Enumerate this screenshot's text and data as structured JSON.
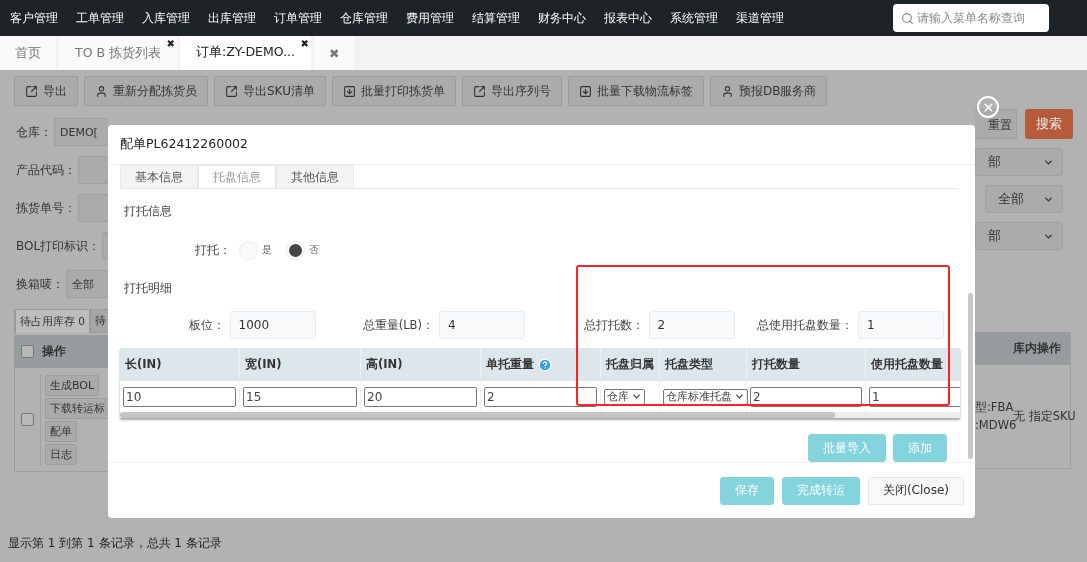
{
  "nav": {
    "items": [
      "客户管理",
      "工单管理",
      "入库管理",
      "出库管理",
      "订单管理",
      "仓库管理",
      "费用管理",
      "结算管理",
      "财务中心",
      "报表中心",
      "系统管理",
      "渠道管理"
    ],
    "search": {
      "placeholder": "请输入菜单名称查询"
    }
  },
  "page_tabs": [
    {
      "label": "首页",
      "selected": false
    },
    {
      "label": "TO B 拣货列表",
      "close": "✖",
      "selected": false
    },
    {
      "label": "订单:ZY-DEMO...",
      "close": "✖",
      "selected": true
    },
    {
      "label": "✖",
      "selected": false
    }
  ],
  "toolbar": [
    {
      "label": "导出",
      "kind": "export"
    },
    {
      "label": "重新分配拣货员",
      "kind": "user"
    },
    {
      "label": "导出SKU清单",
      "kind": "export"
    },
    {
      "label": "批量打印拣货单",
      "kind": "download"
    },
    {
      "label": "导出序列号",
      "kind": "export"
    },
    {
      "label": "批量下载物流标签",
      "kind": "download"
    },
    {
      "label": "预报DB服务商",
      "kind": "user"
    }
  ],
  "filters": [
    {
      "label": "仓库：",
      "value": "DEMO["
    },
    {
      "label": "产品代码："
    },
    {
      "label": "拣货单号："
    },
    {
      "label": "BOL打印标识："
    },
    {
      "label": "换箱唛：",
      "value": "全部"
    }
  ],
  "filter_actions": {
    "reset": "重置",
    "search": "搜索"
  },
  "right_selects": [
    "部",
    "全部",
    "部"
  ],
  "list_table": {
    "tabs": [
      {
        "label": "待占用库存 0",
        "selected": true
      },
      {
        "label": "待",
        "selected": false
      }
    ],
    "header_checked": false,
    "action_column": "操作",
    "last_column": "库内操作",
    "rows": [
      {
        "checked": false,
        "actions": [
          "生成BOL",
          "下载转运标",
          "配单",
          "日志"
        ],
        "info_lines": [
          "型:FBA",
          ":MDW6"
        ],
        "inner_op": "无 指定SKU"
      }
    ]
  },
  "footer": "显示第 1 到第 1 条记录，总共 1 条记录",
  "dialog": {
    "title": "配单PL62412260002",
    "tabs": [
      {
        "label": "基本信息",
        "selected": false
      },
      {
        "label": "托盘信息",
        "selected": true
      },
      {
        "label": "其他信息",
        "selected": false
      }
    ],
    "section_info": "打托信息",
    "palletize": {
      "label": "打托：",
      "options": [
        {
          "label": "是",
          "selected": false
        },
        {
          "label": "否",
          "selected": true
        }
      ]
    },
    "section_detail": "打托明细",
    "summary": [
      {
        "label": "板位：",
        "value": "1000"
      },
      {
        "label": "总重量(LB)：",
        "value": "4"
      },
      {
        "label": "总打托数：",
        "value": "2"
      },
      {
        "label": "总使用托盘数量：",
        "value": "1"
      }
    ],
    "detail_table": {
      "columns": [
        {
          "label": "长(IN)"
        },
        {
          "label": "宽(IN)"
        },
        {
          "label": "高(IN)"
        },
        {
          "label": "单托重量",
          "help": true
        },
        {
          "label": "托盘归属"
        },
        {
          "label": "托盘类型"
        },
        {
          "label": "打托数量"
        },
        {
          "label": "使用托盘数量"
        }
      ],
      "rows": [
        [
          {
            "kind": "input",
            "value": "10"
          },
          {
            "kind": "input",
            "value": "15"
          },
          {
            "kind": "input",
            "value": "20"
          },
          {
            "kind": "input",
            "value": "2"
          },
          {
            "kind": "select",
            "value": "仓库"
          },
          {
            "kind": "select",
            "value": "仓库标准托盘"
          },
          {
            "kind": "input",
            "value": "2"
          },
          {
            "kind": "input",
            "value": "1"
          }
        ]
      ]
    },
    "table_actions": [
      "批量导入",
      "添加"
    ],
    "footer_buttons": [
      {
        "label": "保存",
        "kind": "primary"
      },
      {
        "label": "完成转运",
        "kind": "primary"
      },
      {
        "label": "关闭(Close)",
        "kind": "default"
      }
    ]
  }
}
